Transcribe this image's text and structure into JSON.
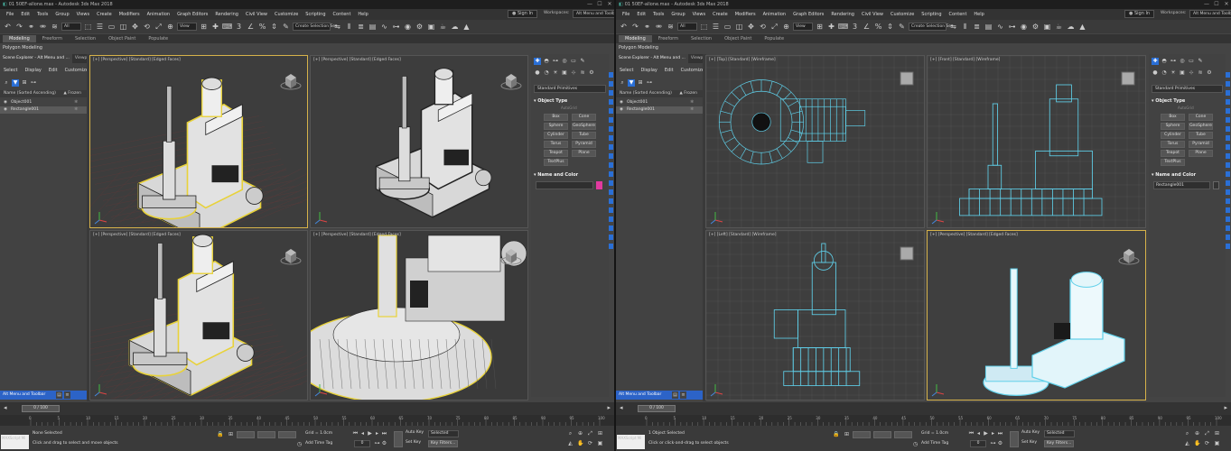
{
  "left": {
    "title": "01 50EF-allone.max - Autodesk 3ds Max 2018",
    "menu": [
      "File",
      "Edit",
      "Tools",
      "Group",
      "Views",
      "Create",
      "Modifiers",
      "Animation",
      "Graph Editors",
      "Rendering",
      "Civil View",
      "Customize",
      "Scripting",
      "Content",
      "Help"
    ],
    "sign_in": "Sign In",
    "workspaces_label": "Workspaces:",
    "workspace": "Alt Menu and Toolbar",
    "filter_select": "All",
    "view_select": "View",
    "selection_set": "Create Selection Se▾",
    "ribbon_tabs": [
      "Modeling",
      "Freeform",
      "Selection",
      "Object Paint",
      "Populate"
    ],
    "ribbon_sub": "Polygon Modeling",
    "explorer": {
      "tabs": [
        "Scene Explorer - Alt Menu and ...",
        "Viewport Layo..."
      ],
      "menu": [
        "Select",
        "Display",
        "Edit",
        "Customize"
      ],
      "header": "Name (Sorted Ascending)",
      "frozen": "▲ Frozen",
      "rows": [
        {
          "name": "Object001",
          "selected": false
        },
        {
          "name": "Rectangle001",
          "selected": true
        }
      ],
      "footer": "Alt Menu and Toolbar"
    },
    "viewports": [
      {
        "label": "[+] [Perspective] [Standard] [Edged Faces]"
      },
      {
        "label": "[+] [Perspective] [Standard] [Edged Faces]"
      },
      {
        "label": "[+] [Perspective] [Standard] [Edged Faces]"
      },
      {
        "label": "[+] [Perspective] [Standard] [Edged Faces]"
      }
    ],
    "command": {
      "dropdown": "Standard Primitives",
      "object_type": "▾ Object Type",
      "autogrid": "AutoGrid",
      "buttons": [
        "Box",
        "Cone",
        "Sphere",
        "GeoSphere",
        "Cylinder",
        "Tube",
        "Torus",
        "Pyramid",
        "Teapot",
        "Plane",
        "TextPlus"
      ],
      "name_and_color": "▾ Name and Color",
      "name_value": "",
      "color": "#e13aa0"
    },
    "timeline": {
      "frame": "0 / 100"
    },
    "ticks": [
      "0",
      "5",
      "10",
      "15",
      "20",
      "25",
      "30",
      "35",
      "40",
      "45",
      "50",
      "55",
      "60",
      "65",
      "70",
      "75",
      "80",
      "85",
      "90",
      "95",
      "100"
    ],
    "status": {
      "maxscript": "MAXScript Mi",
      "selected": "None Selected",
      "prompt": "Click and drag to select and move objects",
      "grid": "Grid = 1.0cm",
      "add_time_tag": "Add Time Tag",
      "auto_key": "Auto Key",
      "set_key": "Set Key",
      "selected_dropdown": "Selected",
      "key_filters": "Key Filters...",
      "frame_value": "0"
    }
  },
  "right": {
    "title": "01 50EF-allone.max - Autodesk 3ds Max 2018",
    "menu": [
      "File",
      "Edit",
      "Tools",
      "Group",
      "Views",
      "Create",
      "Modifiers",
      "Animation",
      "Graph Editors",
      "Rendering",
      "Civil View",
      "Customize",
      "Scripting",
      "Content",
      "Help"
    ],
    "sign_in": "Sign In",
    "workspaces_label": "Workspaces:",
    "workspace": "Alt Menu and Toolbar",
    "filter_select": "All",
    "view_select": "View",
    "selection_set": "Create Selection Se▾",
    "ribbon_tabs": [
      "Modeling",
      "Freeform",
      "Selection",
      "Object Paint",
      "Populate"
    ],
    "ribbon_sub": "Polygon Modeling",
    "explorer": {
      "tabs": [
        "Scene Explorer - Alt Menu and ...",
        "Viewport Layo..."
      ],
      "menu": [
        "Select",
        "Display",
        "Edit",
        "Customize"
      ],
      "header": "Name (Sorted Ascending)",
      "frozen": "▲ Frozen",
      "rows": [
        {
          "name": "Object001",
          "selected": false
        },
        {
          "name": "Rectangle001",
          "selected": true
        }
      ],
      "footer": "Alt Menu and Toolbar"
    },
    "viewports": [
      {
        "label": "[+] [Top] [Standard] [Wireframe]"
      },
      {
        "label": "[+] [Front] [Standard] [Wireframe]"
      },
      {
        "label": "[+] [Left] [Standard] [Wireframe]"
      },
      {
        "label": "[+] [Perspective] [Standard] [Edged Faces]"
      }
    ],
    "command": {
      "dropdown": "Standard Primitives",
      "object_type": "▾ Object Type",
      "autogrid": "AutoGrid",
      "buttons": [
        "Box",
        "Cone",
        "Sphere",
        "GeoSphere",
        "Cylinder",
        "Tube",
        "Torus",
        "Pyramid",
        "Teapot",
        "Plane",
        "TextPlus"
      ],
      "name_and_color": "▾ Name and Color",
      "name_value": "Rectangle001",
      "color": "#333333"
    },
    "timeline": {
      "frame": "0 / 100"
    },
    "ticks": [
      "0",
      "5",
      "10",
      "15",
      "20",
      "25",
      "30",
      "35",
      "40",
      "45",
      "50",
      "55",
      "60",
      "65",
      "70",
      "75",
      "80",
      "85",
      "90",
      "95",
      "100"
    ],
    "status": {
      "maxscript": "MAXScript Mi",
      "selected": "1 Object Selected",
      "prompt": "Click or click-and-drag to select objects",
      "grid": "Grid = 1.0cm",
      "add_time_tag": "Add Time Tag",
      "auto_key": "Auto Key",
      "set_key": "Set Key",
      "selected_dropdown": "Selected",
      "key_filters": "Key Filters...",
      "frame_value": "0"
    }
  },
  "colors": {
    "accent": "#2a6fd6",
    "active_viewport": "#d6b24a",
    "selection_highlight": "#e8d23a",
    "wireframe": "#5fd0ea"
  }
}
